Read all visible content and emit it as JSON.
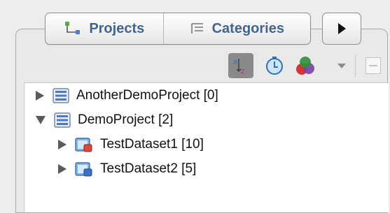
{
  "tabs": [
    {
      "label": "Projects",
      "icon": "project-tree-icon"
    },
    {
      "label": "Categories",
      "icon": "categories-list-icon"
    }
  ],
  "toolbar": {
    "icons": [
      "sort-az-icon",
      "timer-icon",
      "filter-colors-icon",
      "dropdown-arrow-icon",
      "collapse-icon"
    ]
  },
  "tree": {
    "nodes": [
      {
        "label": "AnotherDemoProject [0]",
        "icon": "project-icon",
        "state": "collapsed"
      },
      {
        "label": "DemoProject [2]",
        "icon": "project-icon",
        "state": "expanded"
      },
      {
        "label": "TestDataset1 [10]",
        "icon": "dataset-icon",
        "state": "collapsed"
      },
      {
        "label": "TestDataset2 [5]",
        "icon": "dataset-icon",
        "state": "collapsed"
      }
    ]
  },
  "colors": {
    "tab_text": "#41658f",
    "window_bg": "#ededed",
    "tree_bg": "#ffffff"
  }
}
